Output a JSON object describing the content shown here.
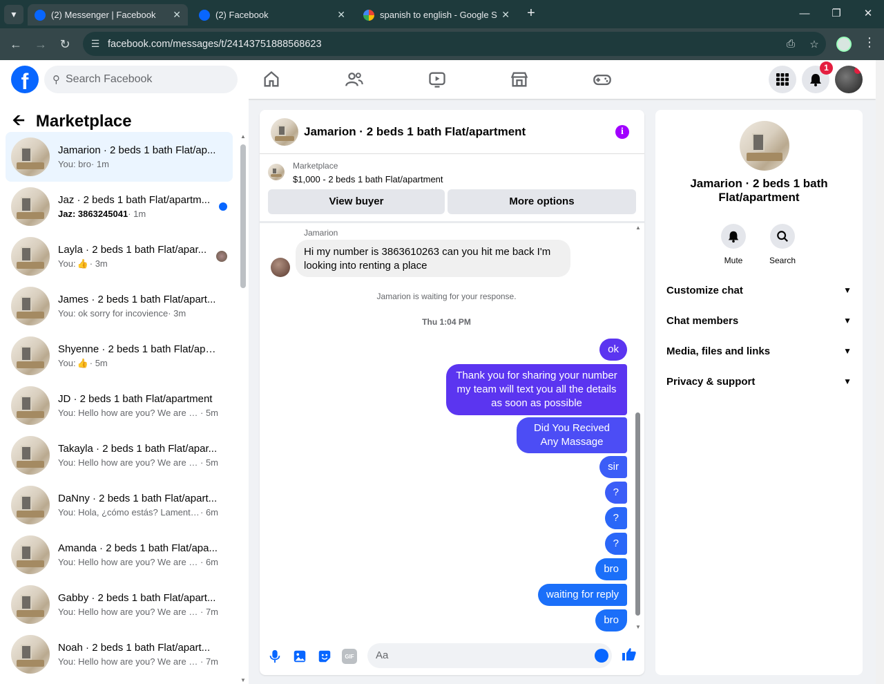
{
  "browser": {
    "tabs": [
      {
        "title": "(2) Messenger | Facebook",
        "active": true
      },
      {
        "title": "(2) Facebook",
        "active": false
      },
      {
        "title": "spanish to english - Google Sea",
        "active": false
      }
    ],
    "url": "facebook.com/messages/t/24143751888568623"
  },
  "header": {
    "search_placeholder": "Search Facebook",
    "notification_count": "1"
  },
  "sidebar": {
    "title": "Marketplace",
    "conversations": [
      {
        "name": "Jamarion · 2 beds 1 bath Flat/ap...",
        "preview": "You: bro",
        "time": "· 1m",
        "selected": true
      },
      {
        "name": "Jaz · 2 beds 1 bath Flat/apartm...",
        "preview": "Jaz: 3863245041",
        "time": "· 1m",
        "unread": true
      },
      {
        "name": "Layla · 2 beds 1 bath Flat/apar...",
        "preview": "You:",
        "time": "· 3m",
        "like": true
      },
      {
        "name": "James · 2 beds 1 bath Flat/apart...",
        "preview": "You: ok sorry for incovience",
        "time": "· 3m"
      },
      {
        "name": "Shyenne · 2 beds 1 bath Flat/apa...",
        "preview": "You:",
        "time": "· 5m",
        "like": true
      },
      {
        "name": "JD · 2 beds 1 bath Flat/apartment",
        "preview": "You: Hello how are you? We are re...",
        "time": "· 5m"
      },
      {
        "name": "Takayla · 2 beds 1 bath Flat/apar...",
        "preview": "You: Hello how are you? We are re...",
        "time": "· 5m"
      },
      {
        "name": "DaNny · 2 beds 1 bath Flat/apart...",
        "preview": "You: Hola, ¿cómo estás? Lamenta...",
        "time": "· 6m"
      },
      {
        "name": "Amanda · 2 beds 1 bath Flat/apa...",
        "preview": "You: Hello how are you? We are re...",
        "time": "· 6m"
      },
      {
        "name": "Gabby · 2 beds 1 bath Flat/apart...",
        "preview": "You: Hello how are you? We are re...",
        "time": "· 7m"
      },
      {
        "name": "Noah · 2 beds 1 bath Flat/apart...",
        "preview": "You: Hello how are you? We are re...",
        "time": "· 7m"
      }
    ]
  },
  "chat": {
    "title": "Jamarion · 2 beds 1 bath Flat/apartment",
    "marketplace_label": "Marketplace",
    "listing": "$1,000 - 2 beds 1 bath Flat/apartment",
    "view_buyer": "View buyer",
    "more_options": "More options",
    "sender": "Jamarion",
    "incoming": "Hi my number is 3863610263 can you hit me back I'm looking into renting a place",
    "waiting": "Jamarion is waiting for your response.",
    "timestamp": "Thu 1:04 PM",
    "outgoing": [
      "ok",
      "Thank you for  sharing your number my team will text you all the details as soon as possible",
      "Did You Recived Any Massage",
      "sir",
      "?",
      "?",
      "?",
      "bro",
      "waiting for reply",
      "bro"
    ],
    "composer_placeholder": "Aa"
  },
  "details": {
    "name": "Jamarion · 2 beds 1 bath Flat/apartment",
    "mute": "Mute",
    "search": "Search",
    "sections": [
      "Customize chat",
      "Chat members",
      "Media, files and links",
      "Privacy & support"
    ]
  }
}
